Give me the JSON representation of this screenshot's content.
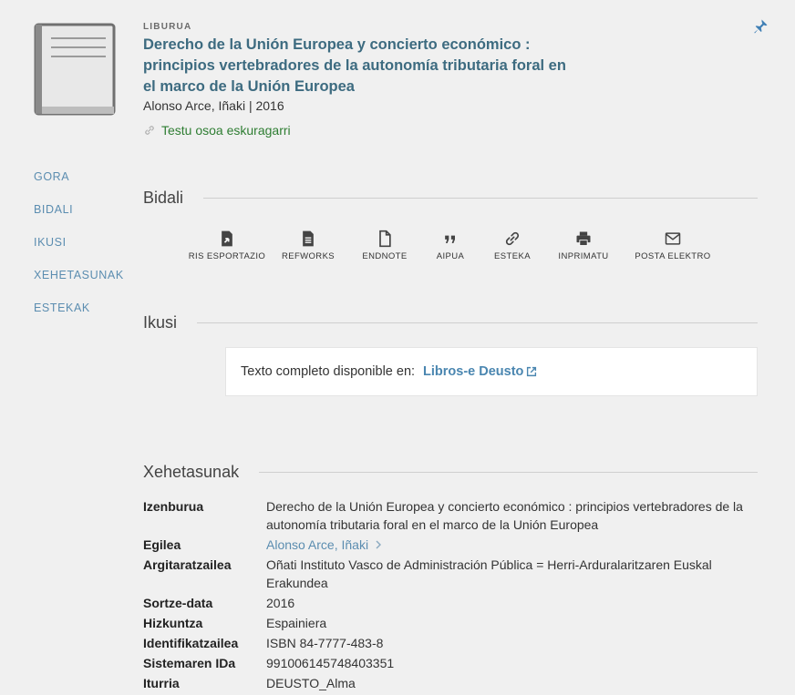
{
  "record": {
    "type_label": "LIBURUA",
    "title": "Derecho de la Unión Europea y concierto económico : principios vertebradores de la autonomía tributaria foral en el marco de la Unión Europea",
    "meta": "Alonso Arce, Iñaki | 2016",
    "availability": "Testu osoa eskuragarri"
  },
  "sidenav": [
    "GORA",
    "BIDALI",
    "IKUSI",
    "XEHETASUNAK",
    "ESTEKAK"
  ],
  "sections": {
    "send": "Bidali",
    "view": "Ikusi",
    "details": "Xehetasunak"
  },
  "actions": [
    {
      "label": "RIS ESPORTAZIO",
      "icon": "ris-export-icon"
    },
    {
      "label": "REFWORKS",
      "icon": "refworks-icon"
    },
    {
      "label": "ENDNOTE",
      "icon": "endnote-icon"
    },
    {
      "label": "AIPUA",
      "icon": "citation-icon"
    },
    {
      "label": "ESTEKA",
      "icon": "permalink-icon"
    },
    {
      "label": "INPRIMATU",
      "icon": "print-icon"
    },
    {
      "label": "POSTA ELEKTRO",
      "icon": "email-icon"
    }
  ],
  "view_it": {
    "label": "Texto completo disponible en:",
    "link": "Libros-e Deusto"
  },
  "details": [
    {
      "key": "Izenburua",
      "value": "Derecho de la Unión Europea y concierto económico : principios vertebradores de la autonomía tributaria foral en el marco de la Unión Europea"
    },
    {
      "key": "Egilea",
      "value": "Alonso Arce, Iñaki"
    },
    {
      "key": "Argitaratzailea",
      "value": "Oñati Instituto Vasco de Administración Pública = Herri-Arduralaritzaren Euskal Erakundea"
    },
    {
      "key": "Sortze-data",
      "value": "2016"
    },
    {
      "key": "Hizkuntza",
      "value": "Espainiera"
    },
    {
      "key": "Identifikatzailea",
      "value": "ISBN 84-7777-483-8"
    },
    {
      "key": "Sistemaren IDa",
      "value": "991006145748403351"
    },
    {
      "key": "Iturria",
      "value": "DEUSTO_Alma"
    }
  ],
  "colors": {
    "title": "#3d6b80",
    "link": "#5b8db0",
    "available": "#2e7d32",
    "background": "#f0f0f0"
  }
}
